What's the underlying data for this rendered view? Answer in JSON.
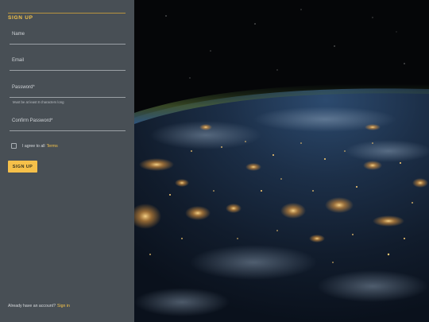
{
  "form": {
    "heading": "SIGN UP",
    "fields": [
      {
        "label": "Name"
      },
      {
        "label": "Email"
      },
      {
        "label": "Password*",
        "hint": "Must be at least 8 characters long"
      },
      {
        "label": "Confirm Password*"
      }
    ],
    "agree_text": "I agree to all",
    "terms_link": "Terms",
    "submit_label": "SIGN UP",
    "footer_text": "Already have an account?",
    "signin_link": "Sign in"
  },
  "colors": {
    "panel_bg": "#484f55",
    "accent": "#f4c34a",
    "button_bg": "#f5c04a"
  },
  "image": {
    "subject": "earth-at-night-from-space-photo"
  }
}
